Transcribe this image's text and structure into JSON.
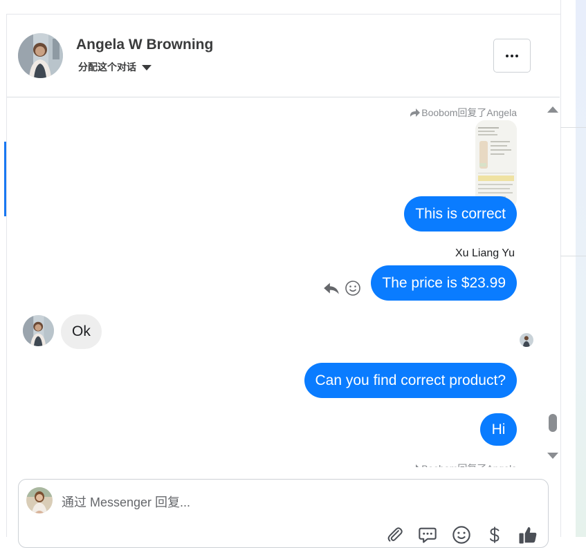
{
  "header": {
    "contact_name": "Angela W Browning",
    "assign_label": "分配这个对话"
  },
  "messages": [
    {
      "type": "reply-note",
      "text": "Boobom回复了Angela"
    },
    {
      "type": "image",
      "direction": "outgoing"
    },
    {
      "type": "outgoing",
      "text": "This is correct"
    },
    {
      "type": "sender",
      "text": "Xu Liang Yu"
    },
    {
      "type": "outgoing",
      "text": "The price is $23.99"
    },
    {
      "type": "incoming",
      "text": "Ok"
    },
    {
      "type": "outgoing",
      "text": "Can you find correct product?"
    },
    {
      "type": "outgoing",
      "text": "Hi"
    },
    {
      "type": "reply-note",
      "text": "Boobom回复了Angela"
    }
  ],
  "composer": {
    "placeholder": "通过 Messenger 回复...",
    "value": ""
  },
  "icons": {
    "more": "more-icon",
    "caret": "caret-down-icon",
    "reply_arrow": "reply-arrow-icon",
    "reply": "reply-icon",
    "emoji": "emoji-icon",
    "attach": "paperclip-icon",
    "saved_replies": "saved-replies-icon",
    "payment": "dollar-icon",
    "like": "thumbs-up-icon"
  },
  "colors": {
    "outgoing_bubble": "#0a7cff",
    "incoming_bubble": "#eeeeee",
    "accent": "#1877f2"
  }
}
